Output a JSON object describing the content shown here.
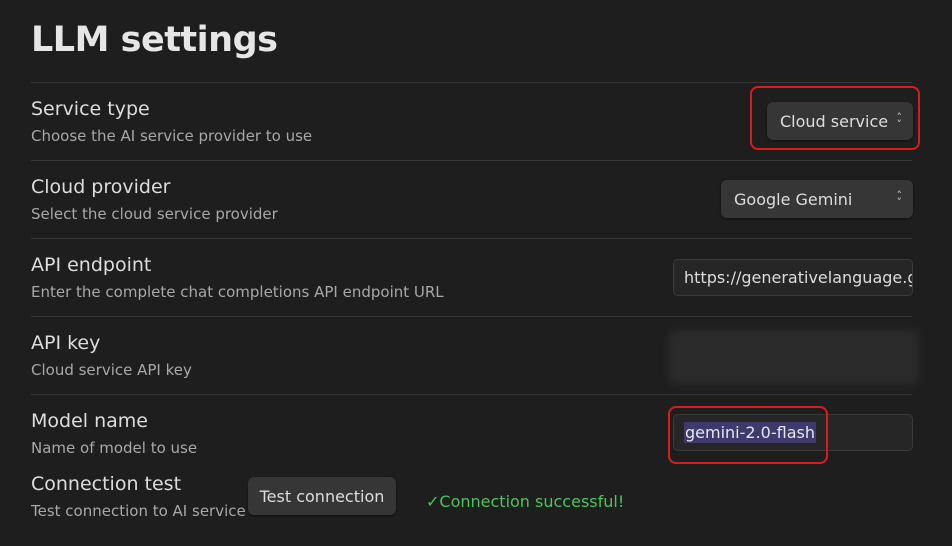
{
  "header": {
    "title": "LLM settings"
  },
  "settings": {
    "service_type": {
      "name": "Service type",
      "desc": "Choose the AI service provider to use",
      "value": "Cloud service"
    },
    "cloud_provider": {
      "name": "Cloud provider",
      "desc": "Select the cloud service provider",
      "value": "Google Gemini"
    },
    "api_endpoint": {
      "name": "API endpoint",
      "desc": "Enter the complete chat completions API endpoint URL",
      "value": "https://generativelanguage.g"
    },
    "api_key": {
      "name": "API key",
      "desc": "Cloud service API key"
    },
    "model_name": {
      "name": "Model name",
      "desc": "Name of model to use",
      "value": "gemini-2.0-flash"
    },
    "connection_test": {
      "name": "Connection test",
      "desc": "Test connection to AI service",
      "button_label": "Test connection",
      "status": "✓Connection successful!"
    }
  },
  "colors": {
    "background": "#1e1e1e",
    "callout": "#e01a1a",
    "success": "#4bc45a",
    "selection": "#3e3a6b"
  },
  "icons": {
    "dropdown": "chevron-up-down-icon"
  }
}
